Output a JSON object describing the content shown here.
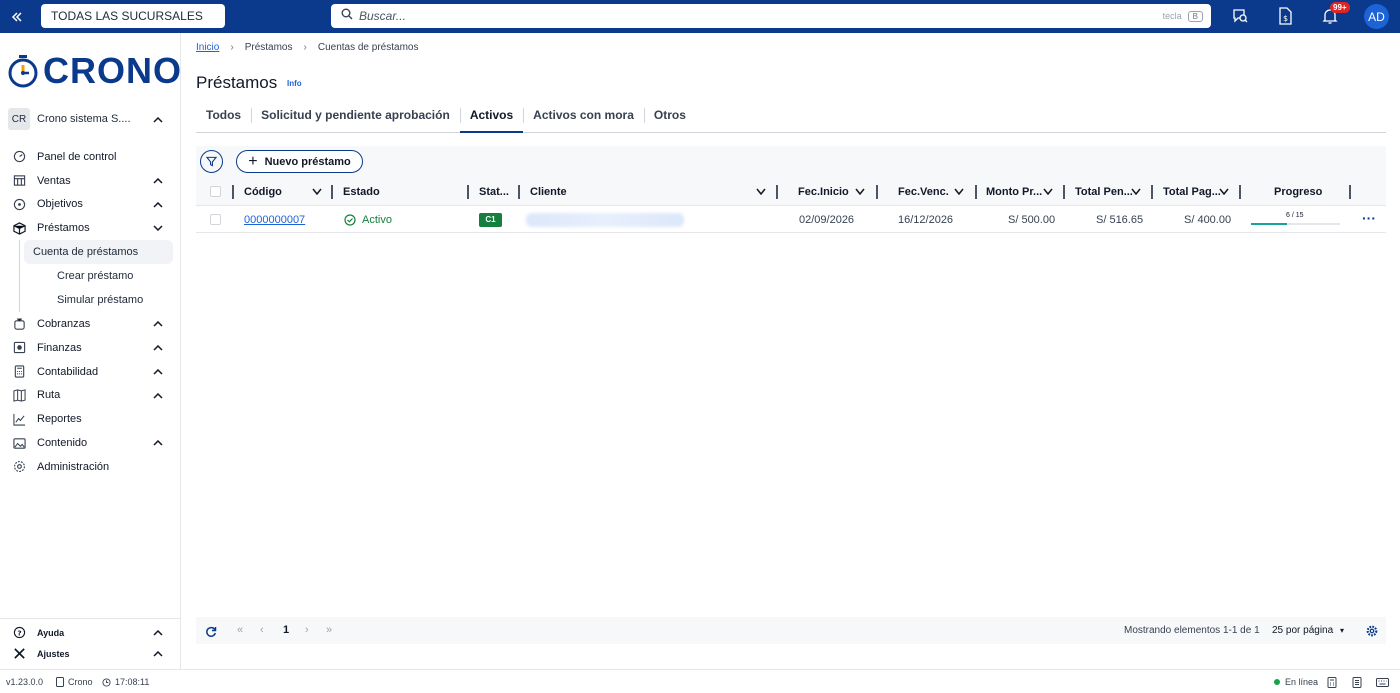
{
  "topbar": {
    "branch_selector": "TODAS LAS SUCURSALES",
    "search_placeholder": "Buscar...",
    "search_key_hint": "tecla",
    "search_key": "B",
    "notification_count": "99+",
    "user_initials": "AD",
    "brand_color": "#0b3a8c"
  },
  "sidebar": {
    "logo_text": "CRONO",
    "org_badge": "CR",
    "org_name": "Crono sistema S....",
    "items": [
      {
        "label": "Panel de control",
        "icon": "dashboard-gauge-icon"
      },
      {
        "label": "Ventas",
        "icon": "store-icon"
      },
      {
        "label": "Objetivos",
        "icon": "target-icon"
      },
      {
        "label": "Préstamos",
        "icon": "box-icon"
      },
      {
        "label": "Cobranzas",
        "icon": "money-bag-icon"
      },
      {
        "label": "Finanzas",
        "icon": "finance-icon"
      },
      {
        "label": "Contabilidad",
        "icon": "calculator-icon"
      },
      {
        "label": "Ruta",
        "icon": "map-icon"
      },
      {
        "label": "Reportes",
        "icon": "chart-line-icon"
      },
      {
        "label": "Contenido",
        "icon": "image-icon"
      },
      {
        "label": "Administración",
        "icon": "gear-icon"
      }
    ],
    "loan_subitems": [
      "Cuenta de préstamos",
      "Crear préstamo",
      "Simular préstamo"
    ],
    "bottom": {
      "help": "Ayuda",
      "settings": "Ajustes"
    }
  },
  "breadcrumb": [
    "Inicio",
    "Préstamos",
    "Cuentas de préstamos"
  ],
  "page": {
    "title": "Préstamos",
    "info_link": "Info"
  },
  "tabs": [
    "Todos",
    "Solicitud y pendiente aprobación",
    "Activos",
    "Activos con mora",
    "Otros"
  ],
  "active_tab": "Activos",
  "toolbar": {
    "new_loan": "Nuevo préstamo"
  },
  "table": {
    "columns": [
      "Código",
      "Estado",
      "Stat...",
      "Cliente",
      "Fec.Inicio",
      "Fec.Venc.",
      "Monto Pr...",
      "Total Pen...",
      "Total Pag...",
      "Progreso"
    ],
    "rows": [
      {
        "code": "0000000007",
        "status": "Activo",
        "stat_badge": "C1",
        "start_date": "02/09/2026",
        "due_date": "16/12/2026",
        "amount": "S/ 500.00",
        "total_pending": "S/ 516.65",
        "total_paid": "S/ 400.00",
        "progress_label": "6 / 15",
        "progress_fraction": 0.4
      }
    ]
  },
  "pagination": {
    "current_page": "1",
    "showing": "Mostrando elementos 1-1 de 1",
    "per_page": "25",
    "per_page_label": "por página"
  },
  "statusbar": {
    "version": "v1.23.0.0",
    "app": "Crono",
    "time": "17:08:11",
    "connection": "En línea"
  }
}
